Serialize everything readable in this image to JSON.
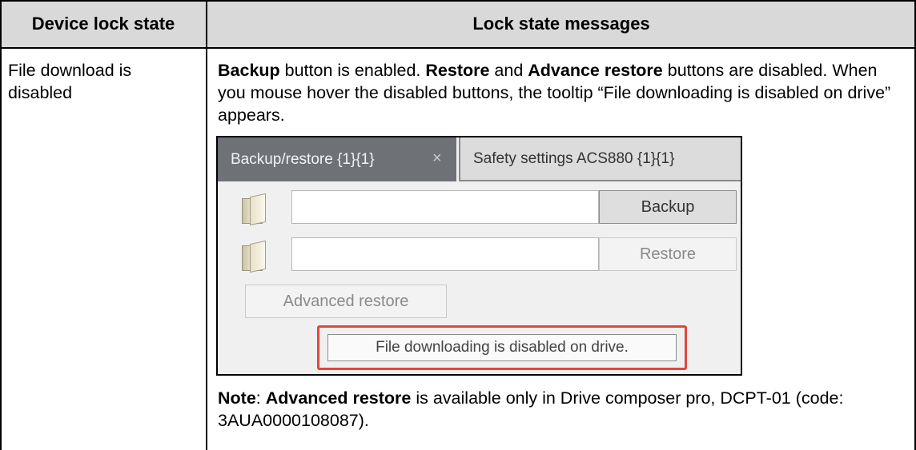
{
  "table": {
    "header": {
      "col1": "Device lock state",
      "col2": "Lock state messages"
    },
    "row": {
      "state": "File download is disabled",
      "message": {
        "backup_bold": "Backup",
        "part1": " button is enabled. ",
        "restore_bold": "Restore",
        "part2": " and ",
        "advance_bold": "Advance restore",
        "part3": " buttons are disabled. When you mouse hover the disabled buttons, the tooltip “File downloading is disabled on drive” appears."
      },
      "note": {
        "note_bold": "Note",
        "colon": ": ",
        "adv_bold": "Advanced restore",
        "rest": " is available only in Drive composer pro, DCPT-01 (code: 3AUA0000108087)."
      }
    }
  },
  "screenshot": {
    "tabs": [
      {
        "label": "Backup/restore {1}{1}",
        "close": "×",
        "active": true
      },
      {
        "label": "Safety settings ACS880 {1}{1}",
        "active": false
      }
    ],
    "backup_field_value": "",
    "restore_field_value": "",
    "backup_button": "Backup",
    "restore_button": "Restore",
    "advanced_restore_button": "Advanced restore",
    "tooltip": "File downloading is disabled on drive.",
    "colors": {
      "active_tab": "#6e7277",
      "highlight_frame": "#e0473c",
      "header_fill": "#d9d9d9"
    },
    "icons": [
      "folder-icon",
      "folder-icon"
    ]
  }
}
